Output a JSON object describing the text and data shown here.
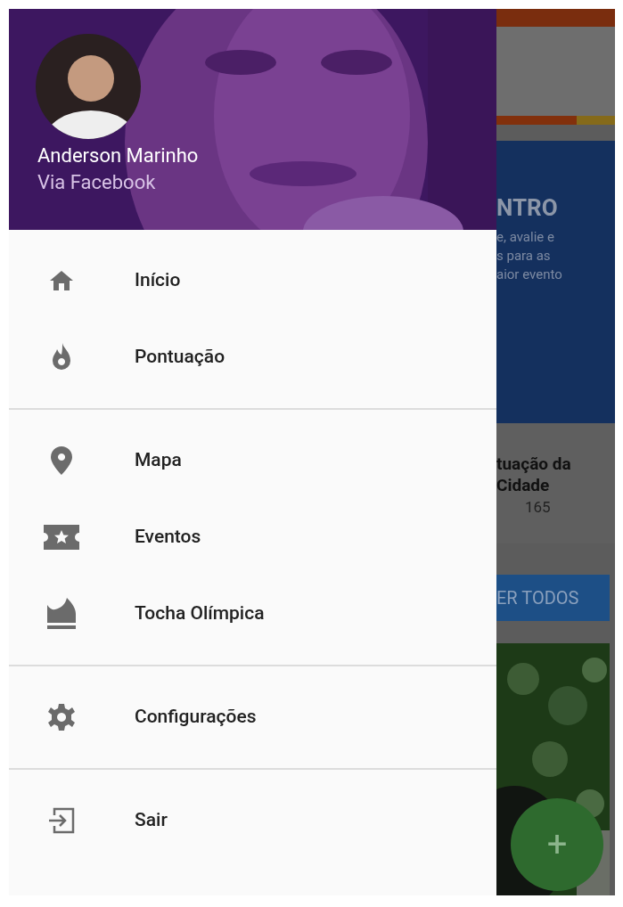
{
  "drawer": {
    "header": {
      "kind": "picture",
      "name": "Anderson Marinho",
      "subtitle": "Via Facebook"
    },
    "sections": [
      {
        "items": [
          {
            "label": "Início"
          },
          {
            "label": "Pontuação"
          }
        ]
      },
      {
        "items": [
          {
            "label": "Mapa"
          },
          {
            "label": "Eventos"
          },
          {
            "label": "Tocha Olímpica"
          }
        ]
      },
      {
        "items": [
          {
            "label": "Configurações"
          }
        ]
      },
      {
        "items": [
          {
            "label": "Sair"
          }
        ]
      }
    ]
  },
  "background": {
    "banner_title": "NTRO",
    "banner_lines": [
      "e, avalie e",
      "s para as",
      "aior evento"
    ],
    "score_card": {
      "title_lines": [
        "tuação da",
        "Cidade"
      ],
      "value": "165"
    },
    "see_all_button": "ER TODOS",
    "photo": {
      "kind": "picture"
    },
    "fab": "+"
  }
}
